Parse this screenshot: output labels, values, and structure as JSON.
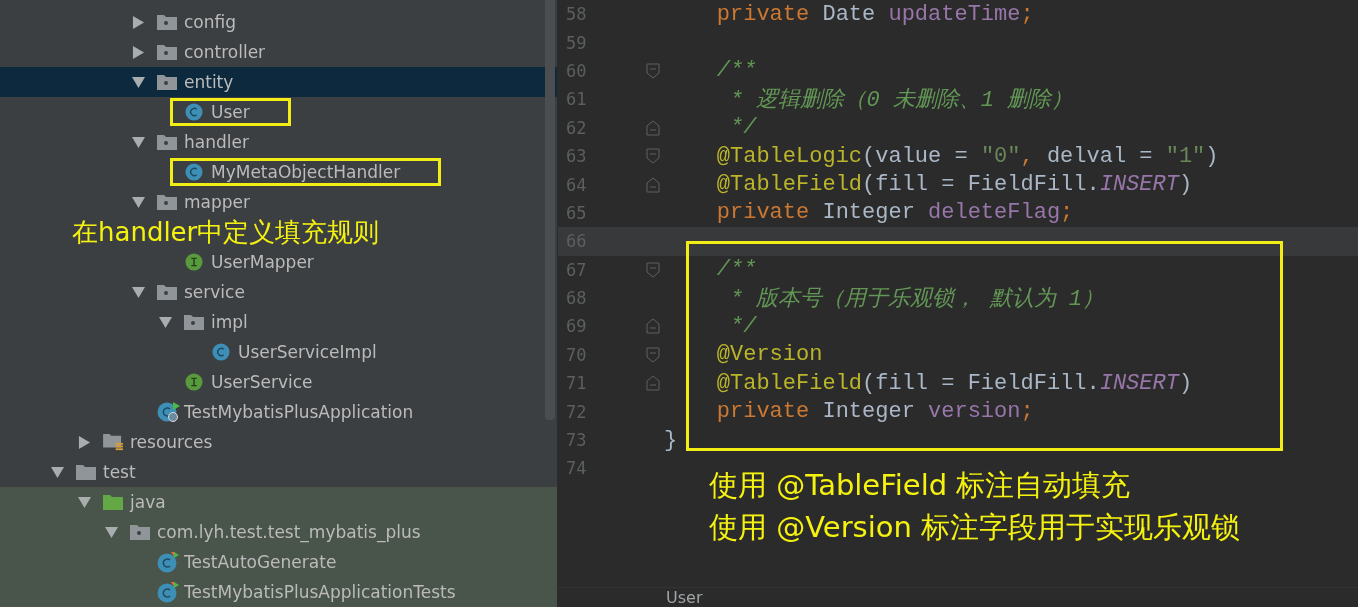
{
  "project_tree": {
    "nodes": [
      {
        "children": [
          {
            "children": [
              {
                "children": [
                  {
                    "label": "config",
                    "kind": "package",
                    "expanded": false
                  },
                  {
                    "label": "controller",
                    "kind": "package",
                    "expanded": false
                  },
                  {
                    "label": "entity",
                    "kind": "package",
                    "expanded": true,
                    "selected": true,
                    "children": [
                      {
                        "label": "User",
                        "kind": "class",
                        "highlighted": true
                      }
                    ]
                  },
                  {
                    "label": "handler",
                    "kind": "package",
                    "expanded": true,
                    "children": [
                      {
                        "label": "MyMetaObjectHandler",
                        "kind": "class",
                        "highlighted": true
                      }
                    ]
                  },
                  {
                    "label": "mapper",
                    "kind": "package",
                    "expanded": true,
                    "children": [
                      {
                        "label": "在handler中定义填充规则",
                        "kind": "note"
                      },
                      {
                        "label": "UserMapper",
                        "kind": "interface"
                      }
                    ]
                  },
                  {
                    "label": "service",
                    "kind": "package",
                    "expanded": true,
                    "children": [
                      {
                        "label": "impl",
                        "kind": "package",
                        "expanded": true,
                        "children": [
                          {
                            "label": "UserServiceImpl",
                            "kind": "class"
                          }
                        ]
                      },
                      {
                        "label": "UserService",
                        "kind": "interface"
                      }
                    ]
                  },
                  {
                    "label": "TestMybatisPlusApplication",
                    "kind": "app-class"
                  }
                ]
              }
            ]
          },
          {
            "label": "resources",
            "kind": "resources-folder",
            "expanded": false
          }
        ]
      },
      {
        "label": "test",
        "kind": "folder",
        "expanded": true,
        "children": [
          {
            "label": "java",
            "kind": "test-root",
            "expanded": true,
            "tinted": true,
            "children": [
              {
                "label": "com.lyh.test.test_mybatis_plus",
                "kind": "package",
                "expanded": true,
                "children": [
                  {
                    "label": "TestAutoGenerate",
                    "kind": "test-class"
                  },
                  {
                    "label": "TestMybatisPlusApplicationTests",
                    "kind": "test-class"
                  }
                ]
              }
            ]
          }
        ]
      }
    ]
  },
  "editor": {
    "lines": [
      {
        "number": "58",
        "tokens": [
          {
            "t": "    private ",
            "kind": "keyword"
          },
          {
            "t": "Date ",
            "kind": "plain"
          },
          {
            "t": "updateTime",
            "kind": "field"
          },
          {
            "t": ";",
            "kind": "keyword"
          }
        ]
      },
      {
        "number": "59"
      },
      {
        "number": "60",
        "fold_start": true,
        "tokens": [
          {
            "t": "    /**",
            "kind": "comment"
          }
        ]
      },
      {
        "number": "61",
        "tokens": [
          {
            "t": "     * 逻辑删除（0 未删除、1 删除）",
            "kind": "comment"
          }
        ]
      },
      {
        "number": "62",
        "fold_end": true,
        "tokens": [
          {
            "t": "     */",
            "kind": "comment"
          }
        ]
      },
      {
        "number": "63",
        "fold_start": true,
        "tokens": [
          {
            "t": "    @TableLogic",
            "kind": "annotation"
          },
          {
            "t": "(value = ",
            "kind": "plain"
          },
          {
            "t": "\"0\"",
            "kind": "string"
          },
          {
            "t": ", ",
            "kind": "keyword"
          },
          {
            "t": "delval = ",
            "kind": "plain"
          },
          {
            "t": "\"1\"",
            "kind": "string"
          },
          {
            "t": ")",
            "kind": "plain"
          }
        ]
      },
      {
        "number": "64",
        "fold_end": true,
        "tokens": [
          {
            "t": "    @TableField",
            "kind": "annotation"
          },
          {
            "t": "(fill = FieldFill.",
            "kind": "plain"
          },
          {
            "t": "INSERT",
            "kind": "static"
          },
          {
            "t": ")",
            "kind": "plain"
          }
        ]
      },
      {
        "number": "65",
        "tokens": [
          {
            "t": "    private ",
            "kind": "keyword"
          },
          {
            "t": "Integer ",
            "kind": "plain"
          },
          {
            "t": "deleteFlag",
            "kind": "field"
          },
          {
            "t": ";",
            "kind": "keyword"
          }
        ]
      },
      {
        "number": "66",
        "current": true
      },
      {
        "number": "67",
        "fold_start": true,
        "tokens": [
          {
            "t": "    /**",
            "kind": "comment"
          }
        ]
      },
      {
        "number": "68",
        "tokens": [
          {
            "t": "     * 版本号（用于乐观锁， 默认为 1）",
            "kind": "comment"
          }
        ]
      },
      {
        "number": "69",
        "fold_end": true,
        "tokens": [
          {
            "t": "     */",
            "kind": "comment"
          }
        ]
      },
      {
        "number": "70",
        "fold_start": true,
        "tokens": [
          {
            "t": "    @Version",
            "kind": "annotation"
          }
        ]
      },
      {
        "number": "71",
        "fold_end": true,
        "tokens": [
          {
            "t": "    @TableField",
            "kind": "annotation"
          },
          {
            "t": "(fill = FieldFill.",
            "kind": "plain"
          },
          {
            "t": "INSERT",
            "kind": "static"
          },
          {
            "t": ")",
            "kind": "plain"
          }
        ]
      },
      {
        "number": "72",
        "tokens": [
          {
            "t": "    private ",
            "kind": "keyword"
          },
          {
            "t": "Integer ",
            "kind": "plain"
          },
          {
            "t": "version",
            "kind": "field"
          },
          {
            "t": ";",
            "kind": "keyword"
          }
        ]
      },
      {
        "number": "73",
        "tokens": [
          {
            "t": "}",
            "kind": "plain"
          }
        ]
      },
      {
        "number": "74"
      }
    ],
    "annotations": [
      "使用 @TableField 标注自动填充",
      "使用 @Version 标注字段用于实现乐观锁"
    ],
    "breadcrumb": "User"
  }
}
